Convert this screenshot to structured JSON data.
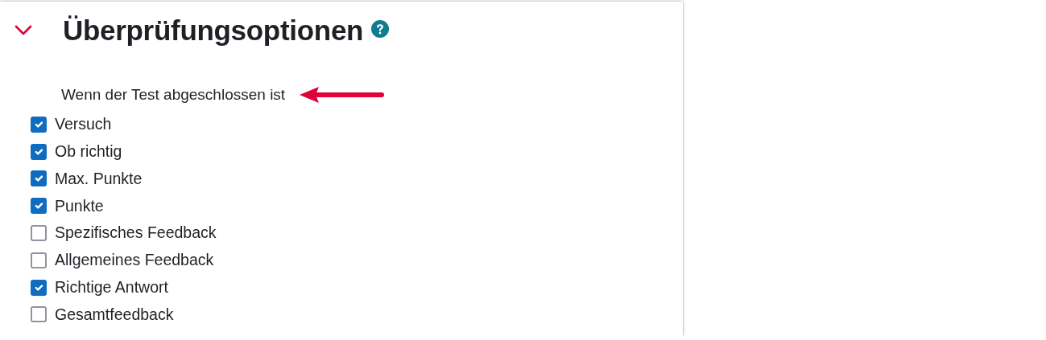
{
  "section": {
    "title": "Überprüfungsoptionen",
    "expanded": true
  },
  "subheading": "Wenn der Test abgeschlossen ist",
  "options": [
    {
      "label": "Versuch",
      "checked": true
    },
    {
      "label": "Ob richtig",
      "checked": true
    },
    {
      "label": "Max. Punkte",
      "checked": true
    },
    {
      "label": "Punkte",
      "checked": true
    },
    {
      "label": "Spezifisches Feedback",
      "checked": false
    },
    {
      "label": "Allgemeines Feedback",
      "checked": false
    },
    {
      "label": "Richtige Antwort",
      "checked": true
    },
    {
      "label": "Gesamtfeedback",
      "checked": false
    }
  ]
}
